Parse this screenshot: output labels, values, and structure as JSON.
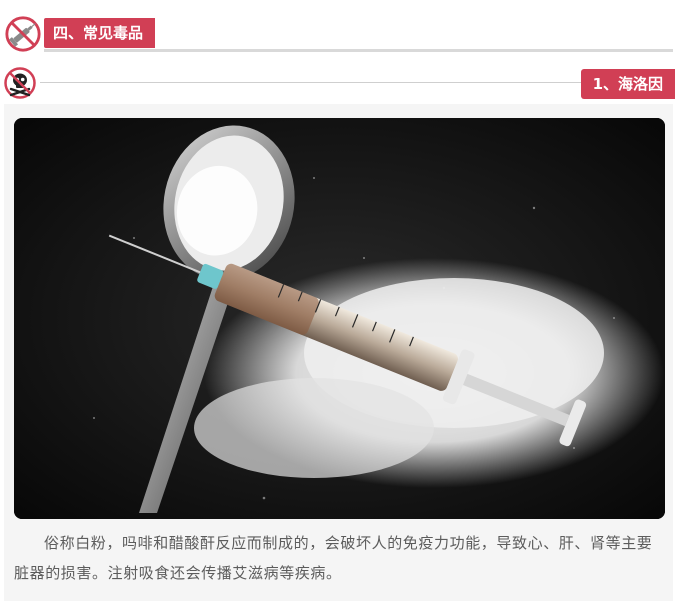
{
  "section": {
    "title": "四、常见毒品",
    "icon": "no-drugs-syringe-icon"
  },
  "subsection": {
    "title": "1、海洛因",
    "icon": "skull-crossbones-icon"
  },
  "photo": {
    "subject": "heroin-syringe-spoon-photo"
  },
  "description": "俗称白粉，吗啡和醋酸酐反应而制成的，会破坏人的免疫力功能，导致心、肝、肾等主要脏器的损害。注射吸食还会传播艾滋病等疾病。",
  "colors": {
    "accent": "#d13f55",
    "text": "#5c5c5c",
    "card": "#f5f5f5",
    "photo_bg": "#111111"
  }
}
